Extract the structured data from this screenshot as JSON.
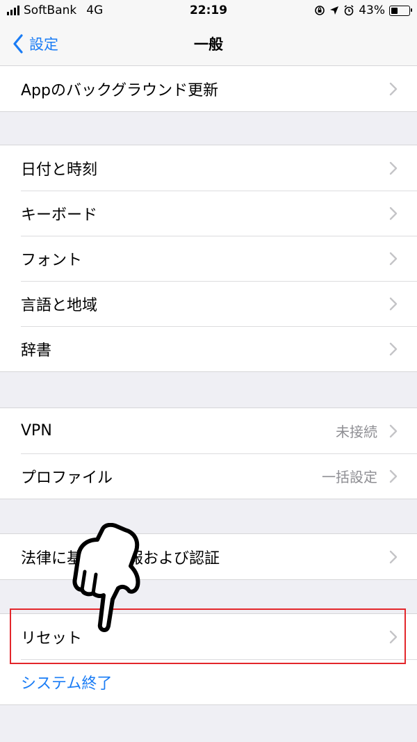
{
  "status_bar": {
    "carrier": "SoftBank",
    "network": "4G",
    "time": "22:19",
    "battery": "43%",
    "battery_level": 0.43,
    "icons": [
      "signal-bars-icon",
      "orientation-lock-icon",
      "location-arrow-icon",
      "alarm-icon",
      "battery-icon"
    ]
  },
  "nav": {
    "back_label": "設定",
    "title": "一般"
  },
  "groups": [
    {
      "rows": [
        {
          "label": "Appのバックグラウンド更新"
        }
      ]
    },
    {
      "rows": [
        {
          "label": "日付と時刻"
        },
        {
          "label": "キーボード"
        },
        {
          "label": "フォント"
        },
        {
          "label": "言語と地域"
        },
        {
          "label": "辞書"
        }
      ]
    },
    {
      "rows": [
        {
          "label": "VPN",
          "value": "未接続"
        },
        {
          "label": "プロファイル",
          "value": "一括設定"
        }
      ]
    },
    {
      "rows": [
        {
          "label": "法律に基づく情報および認証"
        }
      ]
    },
    {
      "rows": [
        {
          "label": "リセット"
        },
        {
          "label": "システム終了"
        }
      ]
    }
  ],
  "annotation": {
    "highlight_color": "#e3262b",
    "pointer_icon": "pointing-hand-icon"
  },
  "colors": {
    "accent": "#1a7cf5",
    "background": "#efeff4"
  }
}
